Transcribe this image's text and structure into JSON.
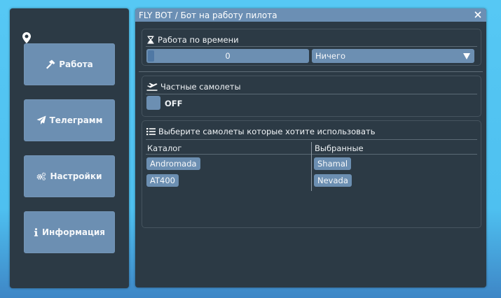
{
  "sidebar": {
    "buttons": [
      {
        "label": "Работа",
        "icon": "hammer-icon"
      },
      {
        "label": "Телеграмм",
        "icon": "paper-plane-icon"
      },
      {
        "label": "Настройки",
        "icon": "cogs-icon"
      },
      {
        "label": "Информация",
        "icon": "info-icon"
      }
    ]
  },
  "window": {
    "title": "FLY BOT / Бот на работу пилота",
    "close_icon": "close-icon"
  },
  "time_panel": {
    "heading": "Работа по времени",
    "icon": "hourglass-icon",
    "slider_value": "0",
    "combo_value": "Ничего"
  },
  "private_panel": {
    "heading": "Частные самолеты",
    "icon": "plane-departure-icon",
    "toggle_label": "OFF"
  },
  "select_panel": {
    "heading": "Выберите самолеты которые хотите использовать",
    "icon": "list-icon",
    "catalog_header": "Каталог",
    "selected_header": "Выбранные",
    "catalog": [
      "Andromada",
      "AT400"
    ],
    "selected": [
      "Shamal",
      "Nevada"
    ]
  },
  "colors": {
    "accent": "#6c8fb2",
    "panel_bg": "#2c3a45",
    "titlebar": "#6b8fb4"
  }
}
